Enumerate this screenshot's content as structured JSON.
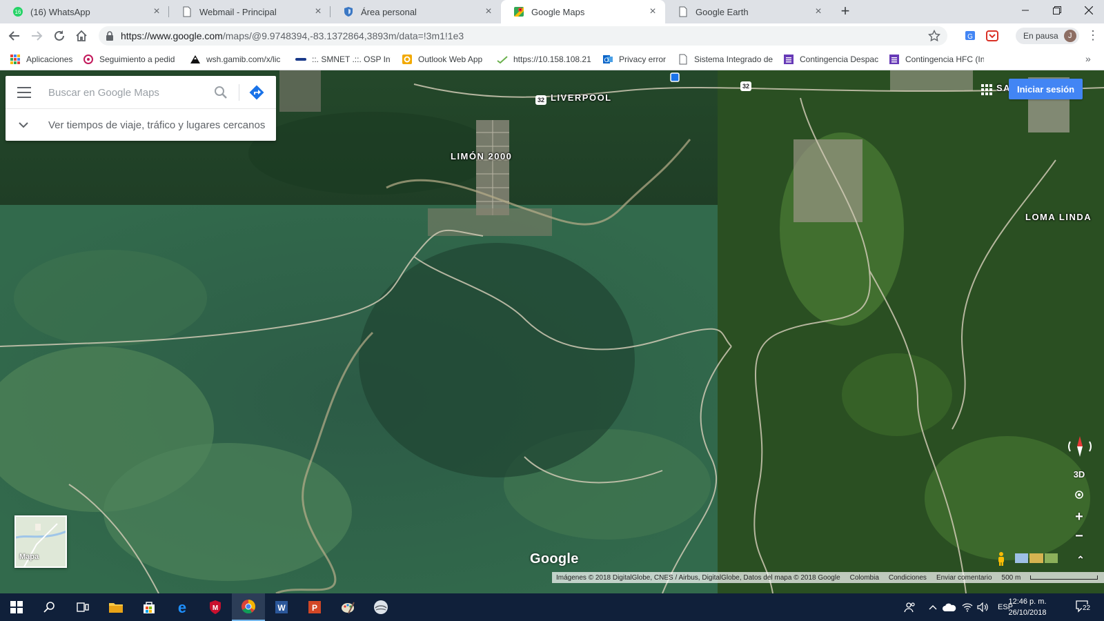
{
  "browser": {
    "tabs": [
      {
        "label": "(16) WhatsApp",
        "icon": "whatsapp-icon",
        "active": false
      },
      {
        "label": "Webmail - Principal",
        "icon": "page-icon",
        "active": false
      },
      {
        "label": "Área personal",
        "icon": "shield-icon",
        "active": false
      },
      {
        "label": "Google Maps",
        "icon": "google-maps-icon",
        "active": true
      },
      {
        "label": "Google Earth",
        "icon": "page-icon",
        "active": false
      }
    ],
    "url": "https://www.google.com/maps/@9.9748394,-83.1372864,3893m/data=!3m1!1e3",
    "url_host": "https://www.google.com",
    "url_path": "/maps/@9.9748394,-83.1372864,3893m/data=!3m1!1e3",
    "profile_status": "En pausa",
    "profile_initial": "J"
  },
  "bookmarks": [
    {
      "label": "Aplicaciones",
      "icon": "apps-grid-icon"
    },
    {
      "label": "Seguimiento a pedid",
      "icon": "tracking-icon"
    },
    {
      "label": "wsh.gamib.com/x/lic",
      "icon": "mountain-icon"
    },
    {
      "label": "::. SMNET .::. OSP Inte",
      "icon": "smnet-icon"
    },
    {
      "label": "Outlook Web App",
      "icon": "outlook-web-icon"
    },
    {
      "label": "https://10.158.108.21",
      "icon": "check-icon"
    },
    {
      "label": "Privacy error",
      "icon": "outlook-icon"
    },
    {
      "label": "Sistema Integrado de",
      "icon": "page-icon"
    },
    {
      "label": "Contingencia Despac",
      "icon": "form-icon"
    },
    {
      "label": "Contingencia HFC (In",
      "icon": "form-icon"
    }
  ],
  "maps": {
    "search_placeholder": "Buscar en Google Maps",
    "nearby_text": "Ver tiempos de viaje, tráfico y lugares cercanos",
    "signin_label": "Iniciar sesión",
    "places": [
      {
        "name": "LIVERPOOL"
      },
      {
        "name": "LIMÓN 2000"
      },
      {
        "name": "LOMA LINDA"
      },
      {
        "name": "SA"
      }
    ],
    "route_shields": [
      "32",
      "32"
    ],
    "mini_map_label": "Mapa",
    "logo": "Google",
    "control_3d": "3D",
    "zoom_in": "+",
    "zoom_out": "−",
    "footer": {
      "attribution": "Imágenes © 2018 DigitalGlobe, CNES / Airbus, DigitalGlobe, Datos del mapa © 2018 Google",
      "country": "Colombia",
      "terms": "Condiciones",
      "feedback": "Enviar comentario",
      "scale": "500 m"
    }
  },
  "taskbar": {
    "apps": [
      {
        "name": "start-icon"
      },
      {
        "name": "search-icon"
      },
      {
        "name": "task-view-icon"
      },
      {
        "name": "file-explorer-icon"
      },
      {
        "name": "store-icon"
      },
      {
        "name": "edge-icon"
      },
      {
        "name": "mcafee-icon"
      },
      {
        "name": "chrome-icon",
        "active": true
      },
      {
        "name": "word-icon"
      },
      {
        "name": "powerpoint-icon"
      },
      {
        "name": "paint-icon"
      },
      {
        "name": "google-earth-icon"
      }
    ],
    "language": "ESP",
    "time": "12:46 p. m.",
    "date": "26/10/2018",
    "notifications": "22"
  },
  "colors": {
    "accent_blue": "#4285f4",
    "taskbar_bg": "#10203a",
    "tabstrip_bg": "#dee1e6"
  }
}
